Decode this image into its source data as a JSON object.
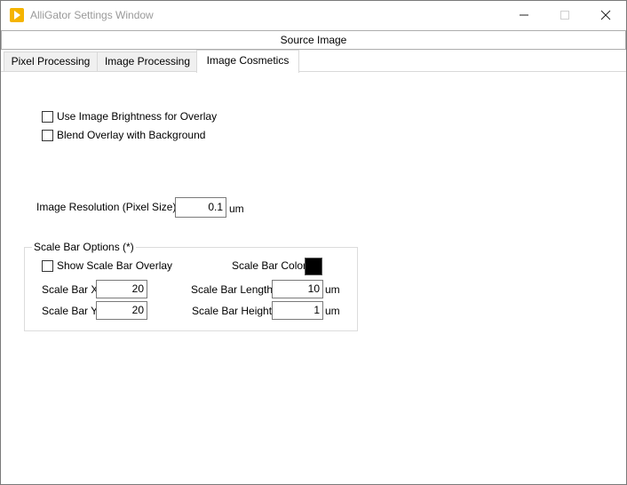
{
  "window": {
    "title": "AlliGator Settings Window",
    "icon": "alligator-app-icon",
    "controls": [
      "minimize-icon",
      "maximize-icon",
      "close-icon"
    ]
  },
  "source_button": {
    "label": "Source Image"
  },
  "tabs": [
    {
      "label": "Pixel Processing",
      "active": false
    },
    {
      "label": "Image Processing",
      "active": false
    },
    {
      "label": "Image Cosmetics",
      "active": true
    }
  ],
  "options": {
    "use_brightness": {
      "label": "Use Image Brightness for Overlay",
      "checked": false
    },
    "blend_overlay": {
      "label": "Blend Overlay with Background",
      "checked": false
    }
  },
  "resolution": {
    "label": "Image Resolution (Pixel Size)",
    "value": "0.1",
    "unit": "um"
  },
  "scale_bar": {
    "group_title": "Scale Bar Options (*)",
    "show_overlay": {
      "label": "Show Scale Bar Overlay",
      "checked": false
    },
    "color": {
      "label": "Scale Bar Color",
      "value": "#000000"
    },
    "x": {
      "label": "Scale Bar X",
      "value": "20"
    },
    "y": {
      "label": "Scale Bar Y",
      "value": "20"
    },
    "length": {
      "label": "Scale Bar Length",
      "value": "10",
      "unit": "um"
    },
    "height": {
      "label": "Scale Bar Height",
      "value": "1",
      "unit": "um"
    }
  }
}
